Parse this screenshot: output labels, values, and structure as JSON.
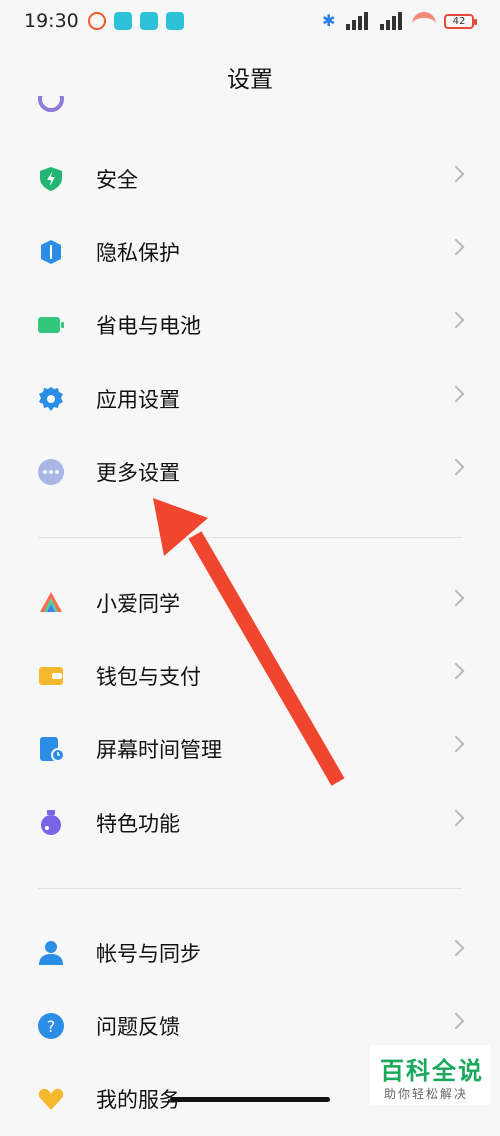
{
  "status": {
    "time": "19:30",
    "battery": "42",
    "colors": {
      "bluetooth": "#2a7de1",
      "battery": "#e24a3b",
      "app": "#2fc1d8"
    }
  },
  "header": {
    "title": "设置"
  },
  "items": [
    {
      "label": "安全",
      "icon": "shield-icon",
      "color": "#22b573"
    },
    {
      "label": "隐私保护",
      "icon": "privacy-icon",
      "color": "#2b8de6"
    },
    {
      "label": "省电与电池",
      "icon": "battery-icon",
      "color": "#34c77b"
    },
    {
      "label": "应用设置",
      "icon": "gear-icon",
      "color": "#2b8de6"
    },
    {
      "label": "更多设置",
      "icon": "more-icon",
      "color": "#8e9bd8"
    },
    {
      "label": "小爱同学",
      "icon": "xiaoai-icon",
      "color": "#ff6a4d"
    },
    {
      "label": "钱包与支付",
      "icon": "wallet-icon",
      "color": "#f5b72e"
    },
    {
      "label": "屏幕时间管理",
      "icon": "screen-time-icon",
      "color": "#2b8de6"
    },
    {
      "label": "特色功能",
      "icon": "feature-icon",
      "color": "#7a63e6"
    },
    {
      "label": "帐号与同步",
      "icon": "account-icon",
      "color": "#2b8de6"
    },
    {
      "label": "问题反馈",
      "icon": "feedback-icon",
      "color": "#2b8de6"
    },
    {
      "label": "我的服务",
      "icon": "service-icon",
      "color": "#f5b72e"
    }
  ],
  "watermark": {
    "line1": "百科全说",
    "line2": "助你轻松解决"
  }
}
